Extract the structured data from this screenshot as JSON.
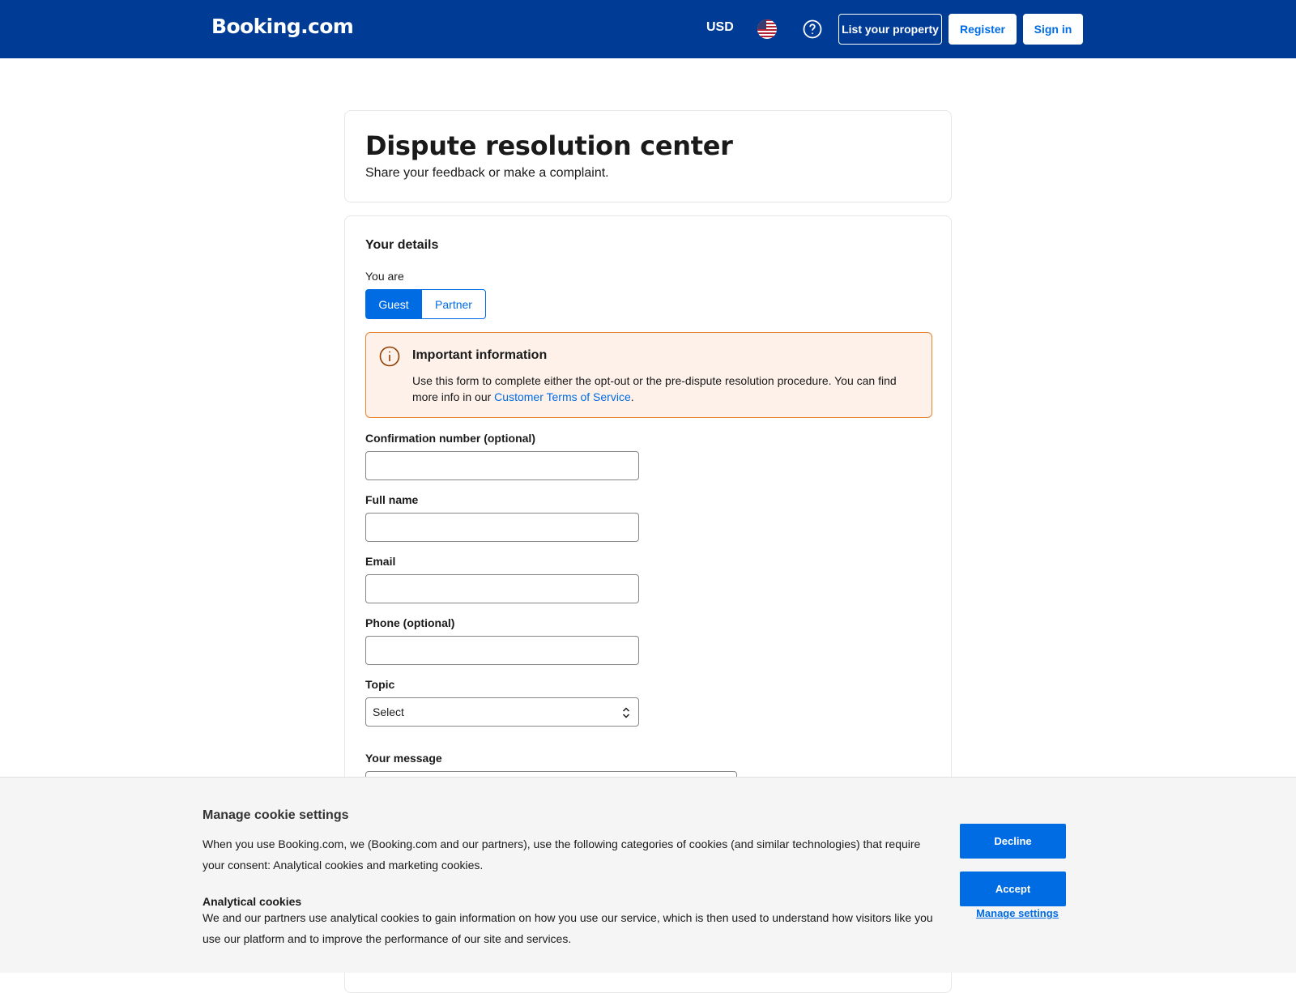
{
  "header": {
    "logo": "Booking.com",
    "currency": "USD",
    "flag_icon": "us-flag-icon",
    "help_icon": "help-circle-icon",
    "list_property": "List your property",
    "register": "Register",
    "sign_in": "Sign in",
    "bg_color": "#003b95"
  },
  "title_card": {
    "title": "Dispute resolution center",
    "subtitle": "Share your feedback or make a complaint."
  },
  "form": {
    "section_title": "Your details",
    "you_are_label": "You are",
    "segments": {
      "guest": "Guest",
      "partner": "Partner",
      "selected": "Guest"
    },
    "info": {
      "title": "Important information",
      "text_before": "Use this form to complete either the opt-out or the pre-dispute resolution procedure. You can find more info in our ",
      "link": "Customer Terms of Service",
      "text_after": "."
    },
    "fields": {
      "confirmation_label": "Confirmation number (optional)",
      "confirmation_value": "",
      "full_name_label": "Full name",
      "full_name_value": "",
      "email_label": "Email",
      "email_value": "",
      "phone_label": "Phone (optional)",
      "phone_value": "",
      "topic_label": "Topic",
      "topic_value": "Select",
      "message_label": "Your message"
    }
  },
  "cookie": {
    "title": "Manage cookie settings",
    "text": "When you use Booking.com, we (Booking.com and our partners), use the following categories of cookies (and similar technologies) that require your consent: Analytical cookies and marketing cookies.",
    "analytical_title": "Analytical cookies",
    "analytical_text": "We and our partners use analytical cookies to gain information on how you use our service, which is then used to understand how visitors like you use our platform and to improve the performance of our site and services.",
    "decline": "Decline",
    "accept": "Accept",
    "manage": "Manage settings"
  },
  "colors": {
    "brand_blue": "#003b95",
    "action_blue": "#006ce4",
    "info_bg": "#fdf1ea",
    "info_border": "#e98532"
  }
}
